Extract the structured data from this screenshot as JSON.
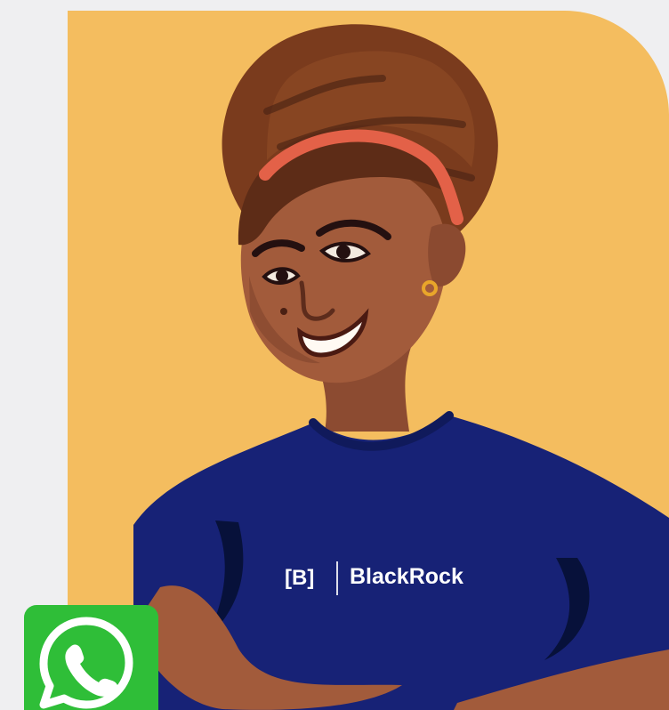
{
  "hero": {
    "background_color": "#f4bd5f",
    "shirt_color": "#172276",
    "shirt_brand_mark": "[B]",
    "shirt_brand_name": "BlackRock",
    "illustration": "smiling-woman-illustration"
  },
  "whatsapp": {
    "icon": "whatsapp-icon",
    "color": "#2fbe38"
  }
}
